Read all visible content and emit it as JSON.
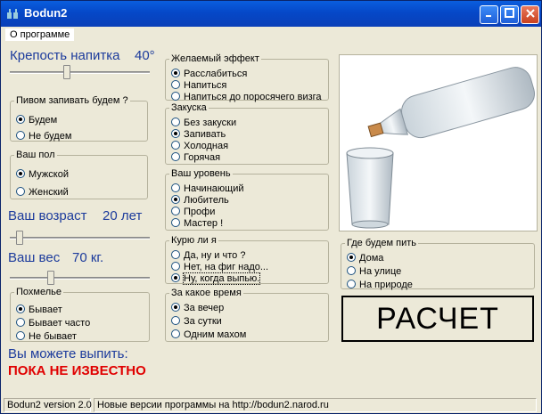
{
  "window": {
    "title": "Bodun2"
  },
  "menu": {
    "items": [
      {
        "label": "О программе"
      }
    ]
  },
  "strength": {
    "label": "Крепость напитка",
    "value": "40°",
    "level": 0.4
  },
  "beer": {
    "legend": "Пивом запивать будем ?",
    "options": [
      "Будем",
      "Не будем"
    ],
    "selected": 0
  },
  "gender": {
    "legend": "Ваш пол",
    "options": [
      "Мужской",
      "Женский"
    ],
    "selected": 0
  },
  "age": {
    "label": "Ваш возраст",
    "value": "20 лет",
    "level": 0.05
  },
  "weight": {
    "label": "Ваш вес",
    "value": "70 кг.",
    "level": 0.28
  },
  "hangover": {
    "legend": "Похмелье",
    "options": [
      "Бывает",
      "Бывает часто",
      "Не бывает"
    ],
    "selected": 0
  },
  "result": {
    "label": "Вы можете выпить:",
    "value": "ПОКА НЕ ИЗВЕСТНО",
    "color": "#e00000"
  },
  "effect": {
    "legend": "Желаемый эффект",
    "options": [
      "Расслабиться",
      "Напиться",
      "Напиться до поросячего визга"
    ],
    "selected": 0
  },
  "snack": {
    "legend": "Закуска",
    "options": [
      "Без закуски",
      "Запивать",
      "Холодная",
      "Горячая"
    ],
    "selected": 1
  },
  "level": {
    "legend": "Ваш уровень",
    "options": [
      "Начинающий",
      "Любитель",
      "Профи",
      "Мастер !"
    ],
    "selected": 1
  },
  "smoke": {
    "legend": "Курю ли я",
    "options": [
      "Да, ну и что ?",
      "Нет, на фиг надо...",
      "Ну, когда выпью."
    ],
    "selected": 2
  },
  "time": {
    "legend": "За какое время",
    "options": [
      "За вечер",
      "За сутки",
      "Одним махом"
    ],
    "selected": 0
  },
  "place": {
    "legend": "Где будем пить",
    "options": [
      "Дома",
      "На улице",
      "На природе"
    ],
    "selected": 0
  },
  "calc": {
    "label": "РАСЧЕТ"
  },
  "status": {
    "version": "Bodun2 version 2.0",
    "message": "Новые версии программы на http://bodun2.narod.ru"
  },
  "colors": {
    "title_bar": "#0548c8",
    "accent_text": "#1c3b9c",
    "result": "#e00000",
    "window_bg": "#ece9d8"
  },
  "icons": {
    "app": "bottle-icon",
    "minimize": "minimize-icon",
    "maximize": "maximize-icon",
    "close": "close-icon"
  }
}
